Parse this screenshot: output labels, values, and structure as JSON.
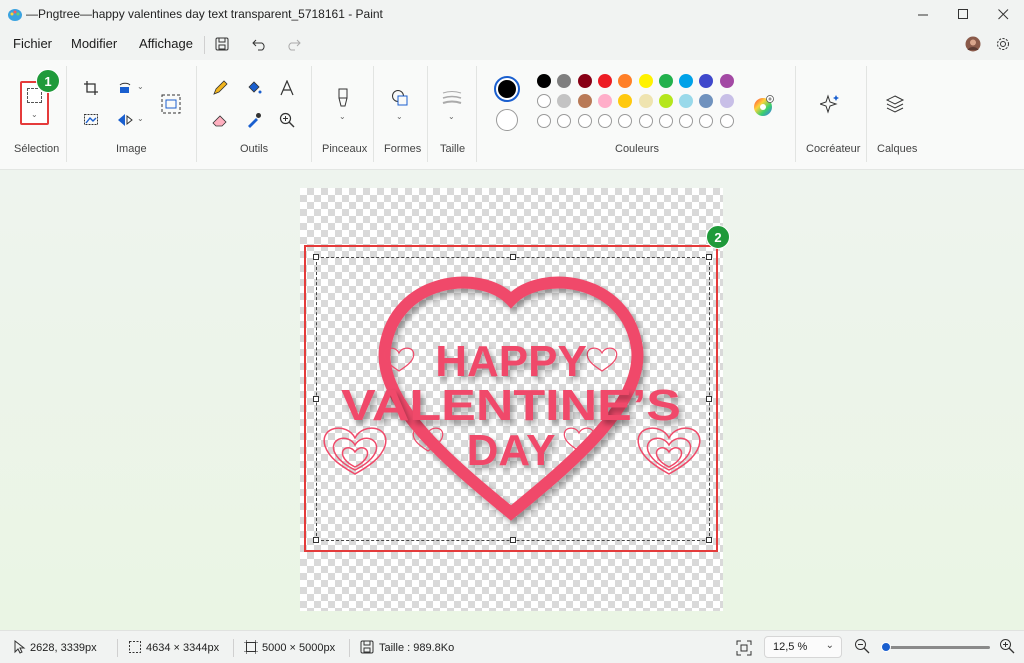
{
  "window": {
    "title": "—Pngtree—happy valentines day text transparent_5718161 - Paint",
    "minimize_icon": "minimize-icon",
    "maximize_icon": "maximize-icon",
    "close_icon": "close-icon"
  },
  "menu": {
    "items": [
      {
        "label": "Fichier"
      },
      {
        "label": "Modifier"
      },
      {
        "label": "Affichage"
      }
    ]
  },
  "ribbon": {
    "groups": {
      "selection": "Sélection",
      "image": "Image",
      "outils": "Outils",
      "pinceaux": "Pinceaux",
      "formes": "Formes",
      "taille": "Taille",
      "couleurs": "Couleurs",
      "cocreateur": "Cocréateur",
      "calques": "Calques"
    },
    "colors": {
      "row1": [
        "#000000",
        "#7f7f7f",
        "#880015",
        "#ed1c24",
        "#ff7f27",
        "#fff200",
        "#22b14c",
        "#00a2e8",
        "#3f48cc",
        "#a349a4"
      ],
      "row2": [
        "#ffffff",
        "#c3c3c3",
        "#b97a57",
        "#ffaec9",
        "#ffc90e",
        "#efe4b0",
        "#b5e61d",
        "#99d9ea",
        "#7092be",
        "#c8bfe7"
      ],
      "primary": "#000000",
      "secondary": "#ffffff"
    }
  },
  "annotations": {
    "badge1": "1",
    "badge2": "2",
    "accent": "#e43b3b",
    "badge_color": "#1f9a3a"
  },
  "artwork": {
    "line1": "HAPPY",
    "line2": "VALENTINE’S",
    "line3": "DAY",
    "color": "#f04a6a"
  },
  "status": {
    "cursor": "2628, 3339px",
    "selection_size": "4634 × 3344px",
    "canvas_size": "5000 × 5000px",
    "file_size": "Taille : 989.8Ko",
    "zoom": "12,5 %"
  }
}
